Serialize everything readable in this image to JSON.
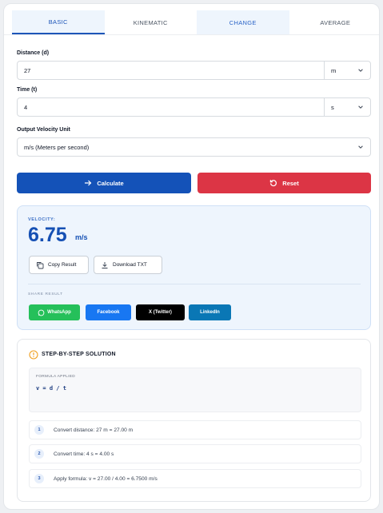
{
  "tabs": [
    {
      "label": "BASIC",
      "state": "active"
    },
    {
      "label": "KINEMATIC",
      "state": "plain"
    },
    {
      "label": "CHANGE",
      "state": "light"
    },
    {
      "label": "AVERAGE",
      "state": "plain"
    }
  ],
  "form": {
    "distance": {
      "label": "Distance (d)",
      "value": "27",
      "unit": "m"
    },
    "time": {
      "label": "Time (t)",
      "value": "4",
      "unit": "s"
    },
    "output": {
      "label": "Output Velocity Unit",
      "value": "m/s (Meters per second)"
    }
  },
  "actions": {
    "calculate": "Calculate",
    "reset": "Reset"
  },
  "result": {
    "label": "VELOCITY:",
    "value": "6.75",
    "unit": "m/s",
    "copy": "Copy Result",
    "download": "Download TXT",
    "share_label": "SHARE RESULT",
    "share": {
      "whatsapp": "WhatsApp",
      "facebook": "Facebook",
      "twitter": "X (Twitter)",
      "linkedin": "LinkedIn"
    }
  },
  "solution": {
    "title": "STEP-BY-STEP SOLUTION",
    "formula_label": "FORMULA APPLIED",
    "formula": "v = d / t",
    "steps": [
      {
        "num": "1",
        "text": "Convert distance: 27 m = 27.00 m"
      },
      {
        "num": "2",
        "text": "Convert time: 4 s = 4.00 s"
      },
      {
        "num": "3",
        "text": "Apply formula: v = 27.00 / 4.00 = 6.7500 m/s"
      }
    ]
  },
  "colors": {
    "primary": "#1452b8",
    "danger": "#dc3545",
    "whatsapp": "#25c05a",
    "facebook": "#1877f2",
    "twitter": "#000000",
    "linkedin": "#0a77b5"
  }
}
